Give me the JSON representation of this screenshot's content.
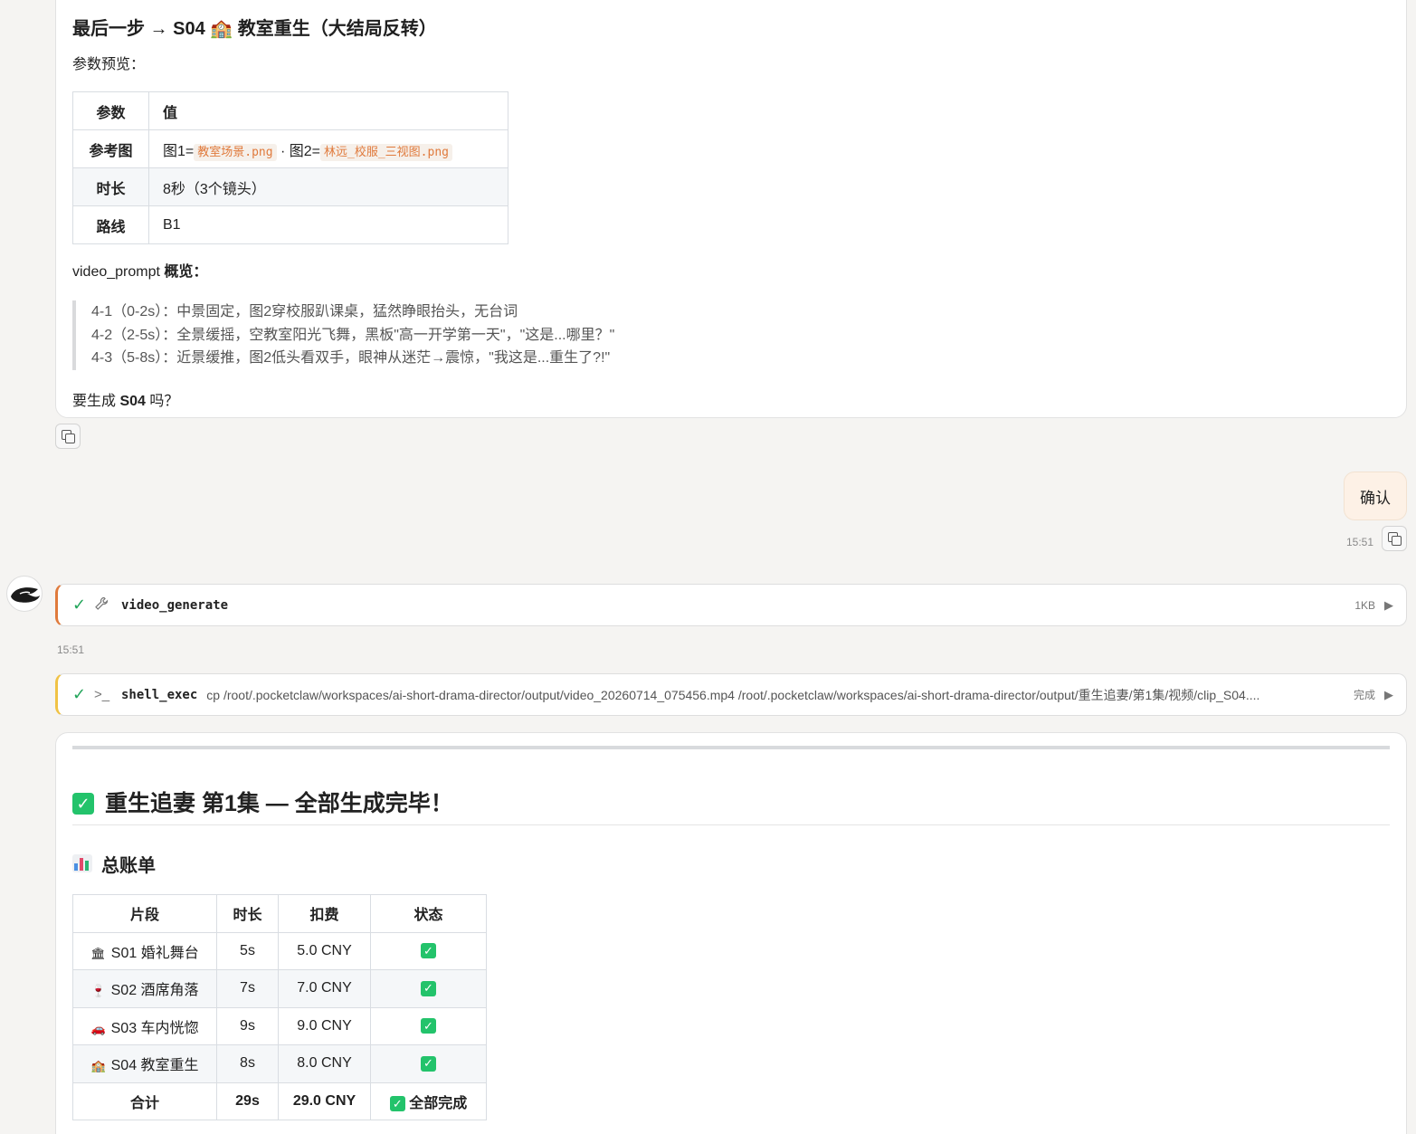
{
  "step_title": "最后一步 → S04 🏫 教室重生（大结局反转）",
  "params_label": "参数预览：",
  "params_table": {
    "headers": [
      "参数",
      "值"
    ],
    "rows": {
      "ref": {
        "key": "参考图",
        "prefix1": "图1=",
        "file1": "教室场景.png",
        "sep": " · 图2=",
        "file2": "林远_校服_三视图.png"
      },
      "duration": {
        "key": "时长",
        "value": "8秒（3个镜头）"
      },
      "route": {
        "key": "路线",
        "value": "B1"
      }
    }
  },
  "video_prompt_label": "video_prompt",
  "video_prompt_suffix": " 概览：",
  "shots": [
    "4-1（0-2s）：中景固定，图2穿校服趴课桌，猛然睁眼抬头，无台词",
    "4-2（2-5s）：全景缓摇，空教室阳光飞舞，黑板\"高一开学第一天\"，\"这是...哪里？\"",
    "4-3（5-8s）：近景缓推，图2低头看双手，眼神从迷茫→震惊，\"我这是...重生了?!\""
  ],
  "ask_prefix": "要生成 ",
  "ask_bold": "S04",
  "ask_suffix": " 吗？",
  "user_message": "确认",
  "user_time": "15:51",
  "tool1": {
    "name": "video_generate",
    "size": "1KB",
    "time": "15:51"
  },
  "tool2": {
    "name": "shell_exec",
    "args": "cp /root/.pocketclaw/workspaces/ai-short-drama-director/output/video_20260714_075456.mp4 /root/.pocketclaw/workspaces/ai-short-drama-director/output/重生追妻/第1集/视频/clip_S04....",
    "status": "完成"
  },
  "done_title": "重生追妻 第1集 — 全部生成完毕！",
  "bill_title": "总账单",
  "bill_table": {
    "headers": [
      "片段",
      "时长",
      "扣费",
      "状态"
    ],
    "rows": [
      {
        "icon": "🏛",
        "segment": "S01 婚礼舞台",
        "duration": "5s",
        "cost": "5.0 CNY"
      },
      {
        "icon": "🍷",
        "segment": "S02 酒席角落",
        "duration": "7s",
        "cost": "7.0 CNY"
      },
      {
        "icon": "🚗",
        "segment": "S03 车内恍惚",
        "duration": "9s",
        "cost": "9.0 CNY"
      },
      {
        "icon": "🏫",
        "segment": "S04 教室重生",
        "duration": "8s",
        "cost": "8.0 CNY"
      }
    ],
    "total": {
      "segment": "合计",
      "duration": "29s",
      "cost": "29.0 CNY",
      "status": "全部完成"
    }
  },
  "colors": {
    "accent_orange": "#e07a3c",
    "accent_yellow": "#f0c245",
    "check_green": "#23c36b"
  }
}
